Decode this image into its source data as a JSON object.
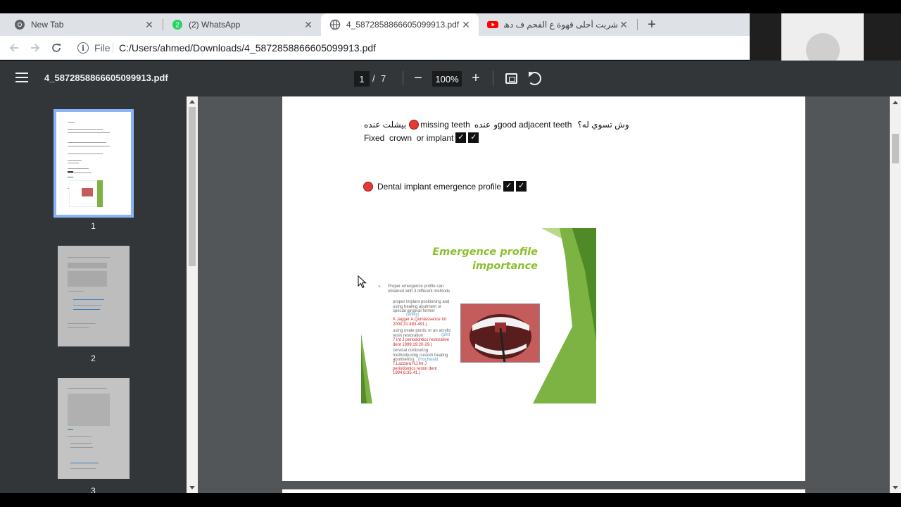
{
  "tabs": [
    {
      "title": "New Tab",
      "icon": "chrome-icon"
    },
    {
      "title": "(2) WhatsApp",
      "icon": "whatsapp-icon",
      "badge": "2"
    },
    {
      "title": "4_5872858866605099913.pdf",
      "icon": "globe-icon",
      "active": true
    },
    {
      "title": "شربت أحلى قهوة ع الفحم ف دهب",
      "icon": "youtube-icon"
    }
  ],
  "toolbar": {
    "scheme": "File",
    "url": "C:/Users/ahmed/Downloads/4_5872858866605099913.pdf"
  },
  "pdf": {
    "title": "4_5872858866605099913.pdf",
    "page": "1",
    "slash": "/",
    "total": "7",
    "zoom": "100%"
  },
  "thumbnails": [
    {
      "label": "1"
    },
    {
      "label": "2"
    },
    {
      "label": "3"
    }
  ],
  "content": {
    "line1_ar_question": "وش تسوي له؟",
    "line1_adjacent": "good adjacent teeth",
    "line1_ar_has": "عنده",
    "line1_missing": "missing teeth",
    "line1_ar_removed": "بيشلت عنده",
    "line2": "Fixed  crown  or implant",
    "line3": "Dental implant emergence profile",
    "check_mark": "✓"
  },
  "slide": {
    "title_line1": "Emergence profile",
    "title_line2": "importance",
    "bullet1": "Proper emergence profile can obtained with 3 different methods",
    "sub1": "proper implant positioning and using healing abutment or special gingival former",
    "sub1_link": "(Wiley)",
    "sub1_ref": "K.Jagger A.Quintessence Int 2000;31:483-491.)",
    "sub2": "using ovate pontic or an acrylic resin restoration",
    "sub2_link": "(pmt",
    "sub2_ref": "7.Int J periodontics restorative dent 1999;19:20-29.)",
    "sub3": "cervical contouring method(using custom healing abutments).",
    "sub3_link": "(Hochwald",
    "sub3_ref": "T.Lazzara RJ,Int J periodontics restor dent 1994;6:35-41.)"
  },
  "colors": {
    "tab_strip": "#dee1e6",
    "pdf_toolbar": "#323639",
    "viewer_bg": "#525659",
    "accent_thumb": "#8ab4f8",
    "slide_green": "#8cbf2e",
    "marker_red": "#e53935"
  }
}
